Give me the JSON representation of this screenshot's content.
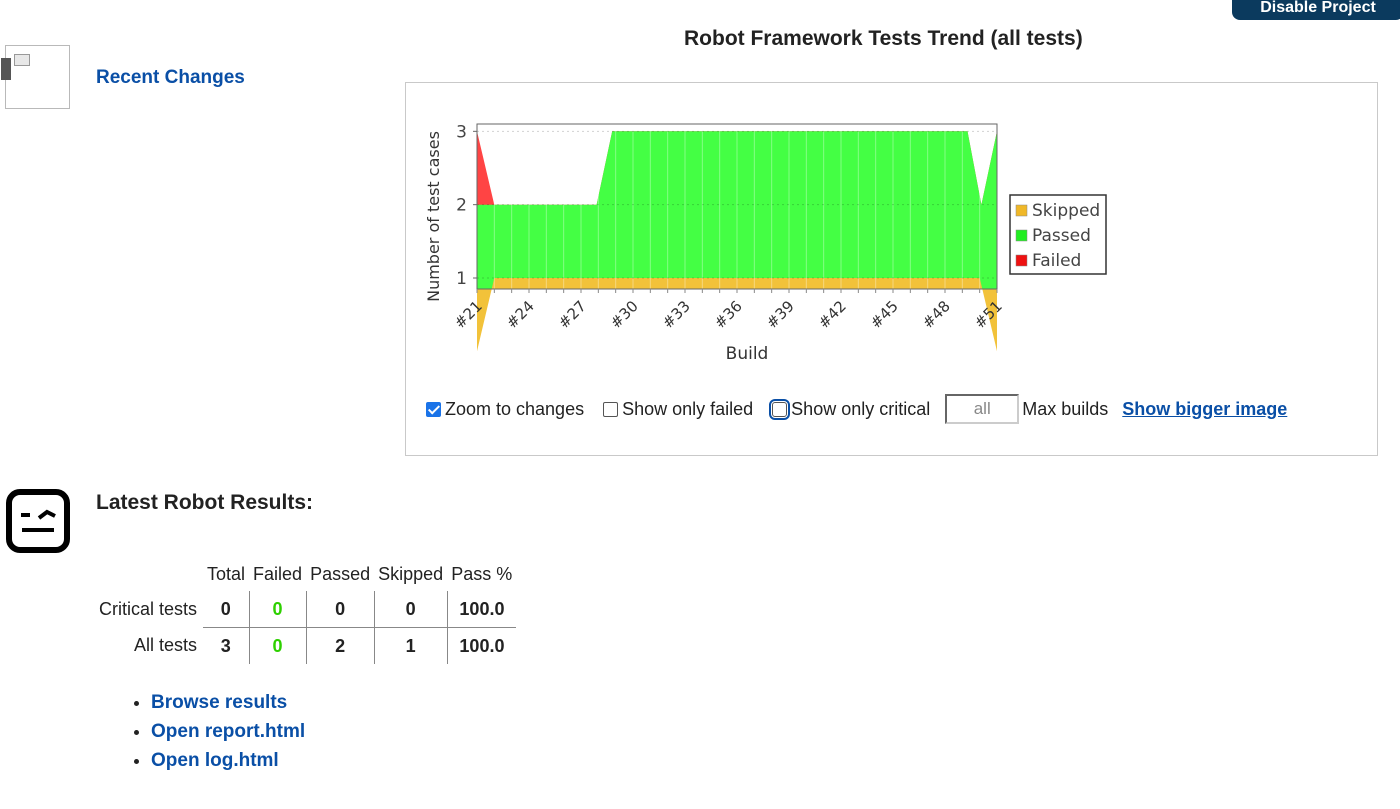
{
  "header": {
    "disable_button": "Disable Project"
  },
  "recent_changes": {
    "label": "Recent Changes"
  },
  "trend": {
    "title": "Robot Framework Tests Trend (all tests)",
    "controls": {
      "zoom_label": "Zoom to changes",
      "zoom_checked": true,
      "only_failed_label": "Show only failed",
      "only_failed_checked": false,
      "only_critical_label": "Show only critical",
      "only_critical_checked": false,
      "max_builds_value": "all",
      "max_builds_label": "Max builds",
      "bigger_image_label": "Show bigger image"
    }
  },
  "chart_data": {
    "type": "area",
    "title": "",
    "xlabel": "Build",
    "ylabel": "Number of test cases",
    "ylim": [
      0.85,
      3.1
    ],
    "yticks": [
      1,
      2,
      3
    ],
    "x_ticks": [
      "#21",
      "#24",
      "#27",
      "#30",
      "#33",
      "#36",
      "#39",
      "#42",
      "#45",
      "#48",
      "#51"
    ],
    "x_range": [
      21,
      51
    ],
    "stacked": true,
    "series": [
      {
        "name": "Skipped",
        "color": "#f2c23a",
        "points": [
          [
            21,
            0
          ],
          [
            22,
            1
          ],
          [
            50,
            1
          ],
          [
            51,
            0
          ]
        ]
      },
      {
        "name": "Passed",
        "color": "#44ff44",
        "points": [
          [
            21,
            2
          ],
          [
            22,
            2
          ],
          [
            27.9,
            2
          ],
          [
            28.8,
            3
          ],
          [
            49.3,
            3
          ],
          [
            50.1,
            2
          ],
          [
            51,
            3
          ]
        ]
      },
      {
        "name": "Failed",
        "color": "#ff4444",
        "points": [
          [
            21,
            3
          ],
          [
            22,
            2
          ],
          [
            27.9,
            2
          ],
          [
            28.8,
            3
          ],
          [
            49.3,
            3
          ],
          [
            50.1,
            2
          ],
          [
            51,
            3
          ]
        ]
      }
    ],
    "legend": [
      "Skipped",
      "Passed",
      "Failed"
    ],
    "legend_position": "right",
    "grid": false
  },
  "latest": {
    "title": "Latest Robot Results:",
    "headers": [
      "Total",
      "Failed",
      "Passed",
      "Skipped",
      "Pass %"
    ],
    "rows": [
      {
        "label": "Critical tests",
        "total": "0",
        "failed": "0",
        "passed": "0",
        "skipped": "0",
        "pass_pct": "100.0"
      },
      {
        "label": "All tests",
        "total": "3",
        "failed": "0",
        "passed": "2",
        "skipped": "1",
        "pass_pct": "100.0"
      }
    ],
    "links": [
      "Browse results",
      "Open report.html",
      "Open log.html"
    ]
  }
}
